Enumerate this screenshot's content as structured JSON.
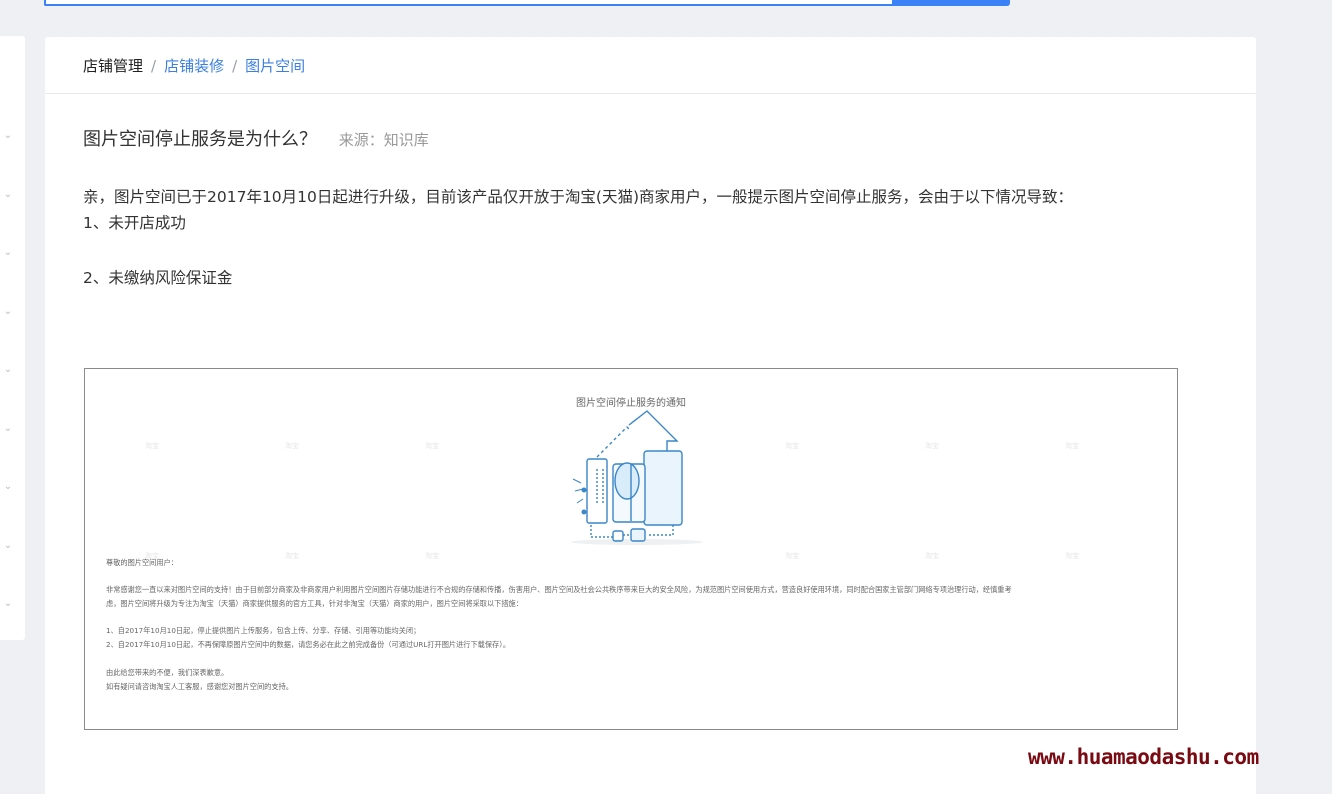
{
  "search": {
    "placeholder": ""
  },
  "breadcrumb": {
    "items": [
      "店铺管理",
      "店铺装修",
      "图片空间"
    ],
    "separator": "/"
  },
  "article": {
    "title": "图片空间停止服务是为什么？",
    "source": "来源：知识库",
    "intro": "亲，图片空间已于2017年10月10日起进行升级，目前该产品仅开放于淘宝(天猫)商家用户，一般提示图片空间停止服务，会由于以下情况导致：",
    "reasons": [
      "1、未开店成功",
      "2、未缴纳风险保证金"
    ]
  },
  "notice": {
    "title": "图片空间停止服务的通知",
    "watermark": "淘宝",
    "greeting": "尊敬的图片空间用户：",
    "body_line1": "非常感谢您一直以来对图片空间的支持！由于目前部分商家及非商家用户利用图片空间图片存储功能进行不合规的存储和传播，伤害用户、图片空间及社会公共秩序带来巨大的安全风险，为规范图片空间使用方式，营造良好使用环境，同时配合国家主管部门网络专项治理行动，经慎重考",
    "body_line2": "虑，图片空间将升级为专注为淘宝（天猫）商家提供服务的官方工具，针对非淘宝（天猫）商家的用户，图片空间将采取以下措施：",
    "measure1": "1、自2017年10月10日起，停止提供图片上传服务，包含上传、分享、存储、引用等功能均关闭；",
    "measure2": "2、自2017年10月10日起，不再保障原图片空间中的数据，请您务必在此之前完成备份（可通过URL打开图片进行下载保存）。",
    "closing1": "由此给您带来的不便，我们深表歉意。",
    "closing2": "如有疑问请咨询淘宝人工客服，感谢您对图片空间的支持。"
  },
  "site_watermark": "www.huamaodashu.com",
  "colors": {
    "accent": "#3b82f6",
    "link": "#3b7fe0",
    "watermark": "#7a0a12"
  },
  "sidebar": {
    "icons": [
      "chevron-down-icon",
      "chevron-down-icon",
      "chevron-down-icon",
      "chevron-down-icon",
      "chevron-down-icon",
      "chevron-down-icon",
      "chevron-down-icon",
      "chevron-down-icon",
      "chevron-down-icon"
    ]
  }
}
